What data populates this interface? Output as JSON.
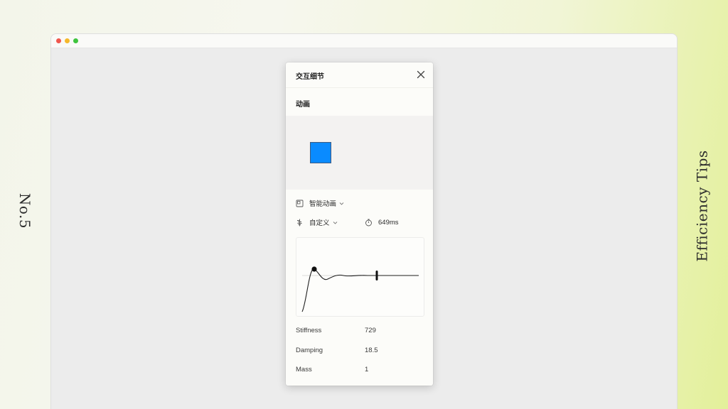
{
  "side": {
    "left_label": "No.5",
    "right_label": "Efficiency Tips"
  },
  "panel": {
    "title": "交互细节",
    "section": "动画",
    "animation_type": "智能动画",
    "easing": "自定义",
    "duration": "649ms",
    "params": [
      {
        "label": "Stiffness",
        "value": "729"
      },
      {
        "label": "Damping",
        "value": "18.5"
      },
      {
        "label": "Mass",
        "value": "1"
      }
    ]
  },
  "colors": {
    "preview_box": "#0a8bff",
    "traffic_red": "#f0564d",
    "traffic_yellow": "#f5b82b",
    "traffic_green": "#3ec43e"
  },
  "icons": [
    "close-icon",
    "smart-animate-icon",
    "easing-icon",
    "timer-icon",
    "chevron-down-icon"
  ]
}
